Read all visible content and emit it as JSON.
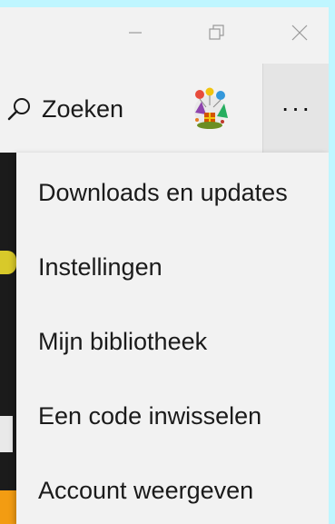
{
  "titlebar": {
    "buttons": [
      "minimize-icon",
      "restore-icon",
      "close-icon"
    ]
  },
  "toolbar": {
    "search_label": "Zoeken",
    "search_icon": "search-icon",
    "avatar_icon": "party-avatar-icon",
    "more_label": "···"
  },
  "menu": {
    "items": [
      {
        "label": "Downloads en updates"
      },
      {
        "label": "Instellingen"
      },
      {
        "label": "Mijn bibliotheek"
      },
      {
        "label": "Een code inwisselen"
      },
      {
        "label": "Account weergeven"
      }
    ]
  },
  "colors": {
    "outer_background": "#bff6ff",
    "window_background": "#f2f2f2",
    "more_button_active": "#e5e5e5"
  }
}
